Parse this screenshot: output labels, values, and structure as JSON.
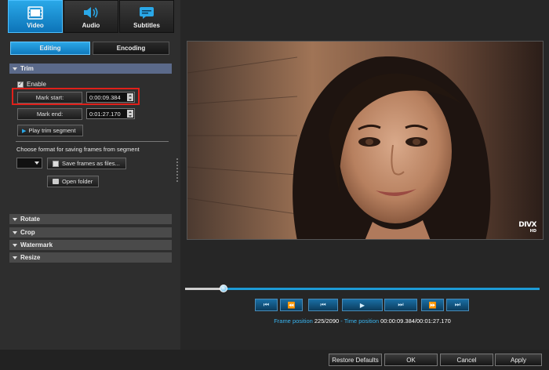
{
  "tabs": {
    "video": {
      "label": "Video",
      "active": true
    },
    "audio": {
      "label": "Audio"
    },
    "subtitles": {
      "label": "Subtitles"
    }
  },
  "subtabs": {
    "editing": {
      "label": "Editing",
      "active": true
    },
    "encoding": {
      "label": "Encoding"
    }
  },
  "sections": {
    "trim": {
      "label": "Trim",
      "expanded": true
    },
    "rotate": {
      "label": "Rotate"
    },
    "crop": {
      "label": "Crop"
    },
    "watermark": {
      "label": "Watermark"
    },
    "resize": {
      "label": "Resize"
    }
  },
  "trim": {
    "enable_label": "Enable",
    "enable_checked": true,
    "mark_start_label": "Mark start:",
    "mark_start_value": "0:00:09.384",
    "mark_end_label": "Mark end:",
    "mark_end_value": "0:01:27.170",
    "play_segment_label": "Play trim segment",
    "choose_format_text": "Choose format for saving frames from segment",
    "format_value": "",
    "save_frames_label": "Save frames as files...",
    "open_folder_label": "Open folder"
  },
  "player": {
    "progress_fraction": 0.108,
    "frame_position_label": "Frame position",
    "frame_position_value": "225/2090",
    "separator": " - ",
    "time_position_label": "Time position",
    "time_position_value": "00:00:09.384/00:01:27.170",
    "watermark_logo": "DIVX HD"
  },
  "transport": [
    {
      "name": "first-frame-icon",
      "glyph": "⏮"
    },
    {
      "name": "rewind-icon",
      "glyph": "⏪"
    },
    {
      "name": "previous-frame-icon",
      "glyph": "⏮"
    },
    {
      "name": "play-icon",
      "glyph": "▶"
    },
    {
      "name": "next-frame-icon",
      "glyph": "⏭"
    },
    {
      "name": "fast-forward-icon",
      "glyph": "⏩"
    },
    {
      "name": "last-frame-icon",
      "glyph": "⏭"
    }
  ],
  "footer": {
    "restore_defaults": "Restore Defaults",
    "ok": "OK",
    "cancel": "Cancel",
    "apply": "Apply"
  },
  "colors": {
    "accent": "#1d9bd6",
    "highlight_box": "#e0201a",
    "time_label": "#38b4f0"
  }
}
